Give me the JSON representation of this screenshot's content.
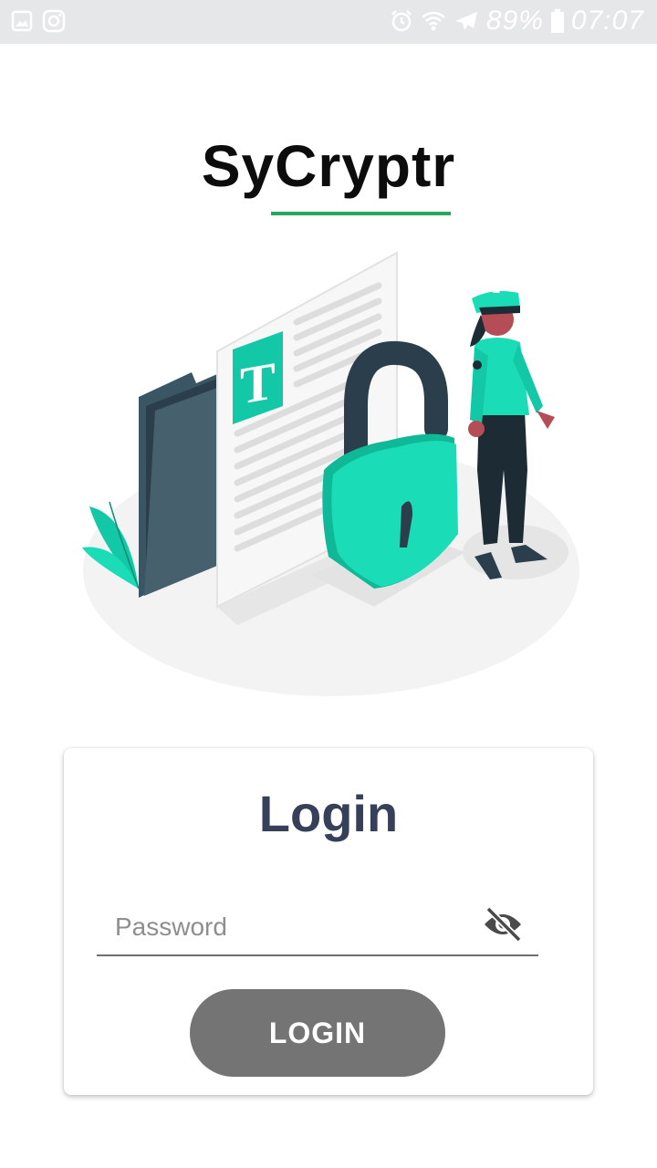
{
  "status_bar": {
    "left_icons": [
      "gallery-icon",
      "instagram-icon"
    ],
    "right_icons": [
      "alarm-icon",
      "wifi-icon",
      "airplane-icon",
      "battery-icon"
    ],
    "battery": "89%",
    "time": "07:07"
  },
  "app": {
    "title": "SyCryptr",
    "accent_color": "#27a75c",
    "illustration": "security-illustration"
  },
  "login": {
    "title": "Login",
    "password_placeholder": "Password",
    "password_value": "",
    "visibility_icon": "eye-off-icon",
    "button_label": "LOGIN",
    "button_color": "#747474"
  }
}
